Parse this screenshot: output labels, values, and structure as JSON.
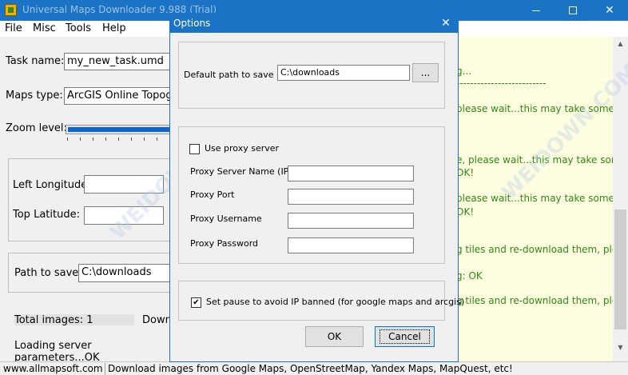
{
  "main_window": {
    "title": "Universal Maps Downloader 9.988 (Trial)",
    "controls": {
      "minimize": "—",
      "maximize": "□",
      "close": "✕"
    }
  },
  "menu": {
    "items": [
      "File",
      "Misc",
      "Tools",
      "Help"
    ]
  },
  "left_panel": {
    "task_name_label": "Task name:",
    "task_name_value": "my_new_task.umd",
    "maps_type_label": "Maps type:",
    "maps_type_value": "ArcGIS Online Topographic",
    "zoom_level_label": "Zoom level:",
    "left_longitude_label": "Left Longitude:",
    "top_latitude_label": "Top Latitude:",
    "path_label": "Path to save:",
    "path_value": "C:\\downloads",
    "total_images": "Total images: 1",
    "download_partial": "Downl",
    "loading_status": "Loading server parameters...OK"
  },
  "log": {
    "lines": [
      "g...",
      "--------------------------",
      "please wait...this may take some time",
      "e, please wait...this may take some time",
      "OK!",
      "please wait...this may take some time",
      "OK!",
      "g tiles and re-download them, please",
      "g: OK",
      "g tiles and re-download them, please"
    ]
  },
  "status_bar": {
    "website": "www.allmapsoft.com",
    "message": "Download images from Google Maps, OpenStreetMap, Yandex Maps, MapQuest, etc!"
  },
  "dialog": {
    "title": "Options",
    "close": "✕",
    "default_path_label": "Default path to save :",
    "default_path_value": "C:\\downloads",
    "browse_label": "...",
    "use_proxy_label": "Use proxy server",
    "use_proxy_checked": false,
    "proxy_server_label": "Proxy Server Name (IP)",
    "proxy_port_label": "Proxy Port",
    "proxy_username_label": "Proxy Username",
    "proxy_password_label": "Proxy Password",
    "proxy_server_value": "",
    "proxy_port_value": "",
    "proxy_username_value": "",
    "proxy_password_value": "",
    "pause_label": "Set pause to avoid IP banned (for google maps and arcgis)",
    "pause_checked": true,
    "check_mark": "✔",
    "ok_label": "OK",
    "cancel_label": "Cancel"
  },
  "watermark": {
    "text": "WEIDOWN.COM"
  },
  "colors": {
    "titlebar": "#1a73c5",
    "log_text": "#2e8b12",
    "log_bg": "#fdfde0",
    "zoom_fill": "#0a64d6"
  }
}
